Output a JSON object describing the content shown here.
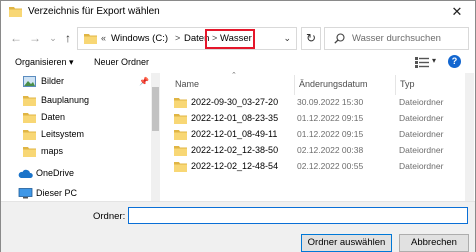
{
  "window": {
    "title": "Verzeichnis für Export wählen",
    "close_glyph": "✕"
  },
  "nav": {
    "back_glyph": "←",
    "forward_glyph": "→",
    "dropdown_glyph": "⌄",
    "up_glyph": "↑",
    "address": {
      "overflow": "«",
      "parts": [
        "Windows (C:)",
        "Daten",
        "Wasser"
      ],
      "separator": ">",
      "dropdown_glyph": "⌄"
    },
    "refresh_glyph": "↻",
    "search_placeholder": "Wasser durchsuchen"
  },
  "toolbar": {
    "organize_label": "Organisieren ▾",
    "new_folder_label": "Neuer Ordner",
    "view_dropdown_glyph": "▾",
    "help_label": "?"
  },
  "sidebar": {
    "items": [
      {
        "label": "Bilder",
        "icon": "pictures-icon",
        "pinned": true
      },
      {
        "label": "Bauplanung",
        "icon": "folder-icon"
      },
      {
        "label": "Daten",
        "icon": "folder-icon"
      },
      {
        "label": "Leitsystem",
        "icon": "folder-icon"
      },
      {
        "label": "maps",
        "icon": "folder-icon"
      },
      {
        "label": "OneDrive",
        "icon": "onedrive-icon"
      },
      {
        "label": "Dieser PC",
        "icon": "this-pc-icon"
      }
    ]
  },
  "filelist": {
    "columns": {
      "name": "Name",
      "date": "Änderungsdatum",
      "type": "Typ"
    },
    "rows": [
      {
        "name": "2022-09-30_03-27-20",
        "date": "30.09.2022 15:30",
        "type": "Dateiordner"
      },
      {
        "name": "2022-12-01_08-23-35",
        "date": "01.12.2022 09:15",
        "type": "Dateiordner"
      },
      {
        "name": "2022-12-01_08-49-11",
        "date": "01.12.2022 09:15",
        "type": "Dateiordner"
      },
      {
        "name": "2022-12-02_12-38-50",
        "date": "02.12.2022 00:38",
        "type": "Dateiordner"
      },
      {
        "name": "2022-12-02_12-48-54",
        "date": "02.12.2022 00:55",
        "type": "Dateiordner"
      }
    ]
  },
  "bottom": {
    "folder_label": "Ordner:",
    "folder_value": "",
    "select_button": "Ordner auswählen",
    "cancel_button": "Abbrechen"
  },
  "colors": {
    "accent": "#0078d7",
    "highlight_border": "#e5162a",
    "folder_yellow": "#f8d775",
    "folder_dark": "#e0b544"
  }
}
